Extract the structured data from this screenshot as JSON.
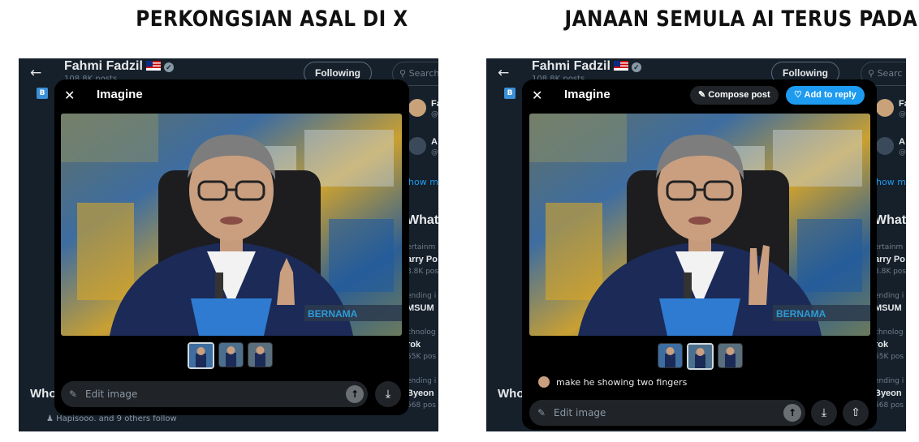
{
  "left": {
    "heading": "PERKONGSIAN ASAL DI X",
    "profile": {
      "back": "←",
      "name": "Fahmi Fadzil",
      "posts": "108.8K posts",
      "follow": "Following",
      "search": "Search"
    },
    "sidebar": {
      "a1": "Fa",
      "a1b": "@",
      "a2": "A",
      "a2b": "@",
      "show": "how m",
      "whats": "What'",
      "t1cat": "ertainm",
      "t1": "arry Po",
      "t1c": "3.8K pos",
      "t2cat": "ending i",
      "t2": "MSUM",
      "t3cat": "chnolog",
      "t3": "rok",
      "t3c": "55K pos",
      "t4cat": "ending i",
      "t4": "Byeon",
      "t4c": "568 pos"
    },
    "who": "Who",
    "follows": "Hapisooo. and 9 others follow",
    "modal": {
      "close": "✕",
      "title": "Imagine",
      "edit_placeholder": "Edit image"
    },
    "watermark": "BERNAMA"
  },
  "right": {
    "heading": "JANAAN SEMULA AI TERUS PADA X",
    "profile": {
      "back": "←",
      "name": "Fahmi Fadzil",
      "posts": "108.8K posts",
      "follow": "Following",
      "search": "Searc"
    },
    "sidebar": {
      "a1": "Fa",
      "a1b": "@",
      "a2": "A",
      "a2b": "@",
      "show": "how m",
      "whats": "What'",
      "t1cat": "ertainm",
      "t1": "arry Po",
      "t1c": "3.8K pos",
      "t2cat": "ending i",
      "t2": "MSUM",
      "t3cat": "chnolog",
      "t3": "rok",
      "t3c": "55K pos",
      "t4cat": "ending i",
      "t4": "Byeon",
      "t4c": "568 pos"
    },
    "who": "Who",
    "modal": {
      "close": "✕",
      "title": "Imagine",
      "compose": "Compose post",
      "reply": "Add to reply",
      "prompt": "make he showing two fingers",
      "edit_placeholder": "Edit image"
    },
    "watermark": "BERNAMA"
  },
  "colors": {
    "x_dark": "#15202b",
    "accent": "#1d9bf0",
    "bernama_blue": "#2e7bd1"
  },
  "icons": [
    "back-arrow-icon",
    "verified-icon",
    "flag-icon",
    "search-icon",
    "close-icon",
    "pen-icon",
    "reply-icon",
    "edit-image-icon",
    "send-arrow-icon",
    "download-icon",
    "share-icon"
  ]
}
